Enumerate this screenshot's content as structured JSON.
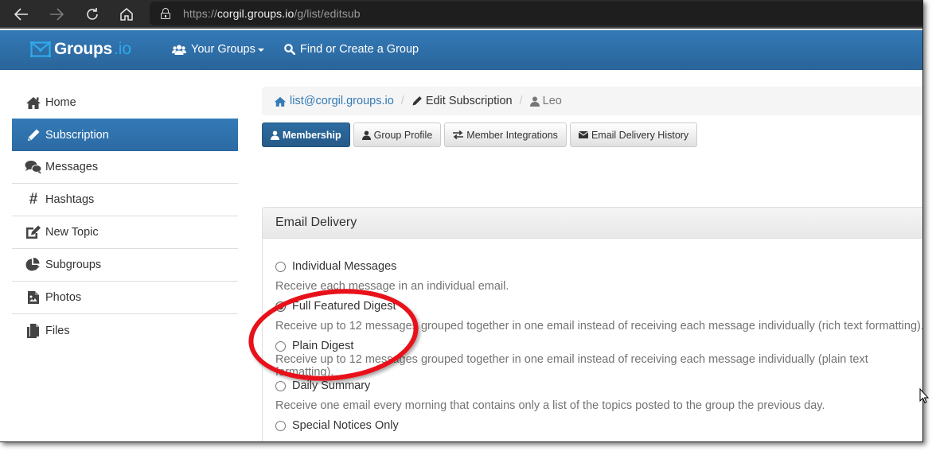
{
  "browser": {
    "url_prefix": "https://",
    "url_host": "corgil.groups.io",
    "url_path": "/g/list/editsub",
    "icons": [
      "back-arrow-icon",
      "forward-arrow-icon",
      "reload-icon",
      "home-icon",
      "lock-icon"
    ]
  },
  "navbar": {
    "brand_name": "Groups",
    "brand_tld": ".io",
    "your_groups_label": "Your Groups",
    "find_label": "Find or Create a Group"
  },
  "sidebar": {
    "items": [
      {
        "label": "Home",
        "icon": "home-icon",
        "active": false
      },
      {
        "label": "Subscription",
        "icon": "pencil-icon",
        "active": true
      },
      {
        "label": "Messages",
        "icon": "comments-icon",
        "active": false
      },
      {
        "label": "Hashtags",
        "icon": "hashtag-icon",
        "active": false
      },
      {
        "label": "New Topic",
        "icon": "edit-icon",
        "active": false
      },
      {
        "label": "Subgroups",
        "icon": "pie-chart-icon",
        "active": false
      },
      {
        "label": "Photos",
        "icon": "photo-file-icon",
        "active": false
      },
      {
        "label": "Files",
        "icon": "files-icon",
        "active": false
      }
    ]
  },
  "breadcrumb": {
    "group": "list@corgil.groups.io",
    "page": "Edit Subscription",
    "user": "Leo",
    "separator": "/"
  },
  "tabs": [
    {
      "label": "Membership",
      "icon": "user-icon",
      "active": true
    },
    {
      "label": "Group Profile",
      "icon": "user-icon",
      "active": false
    },
    {
      "label": "Member Integrations",
      "icon": "exchange-icon",
      "active": false
    },
    {
      "label": "Email Delivery History",
      "icon": "envelope-icon",
      "active": false
    }
  ],
  "email_delivery": {
    "title": "Email Delivery",
    "selected": "Full Featured Digest",
    "options": [
      {
        "label": "Individual Messages",
        "checked": false,
        "description": "Receive each message in an individual email."
      },
      {
        "label": "Full Featured Digest",
        "checked": true,
        "description": "Receive up to 12 messages grouped together in one email instead of receiving each message individually (rich text formatting)."
      },
      {
        "label": "Plain Digest",
        "checked": false,
        "description": "Receive up to 12 messages grouped together in one email instead of receiving each message individually (plain text formatting)."
      },
      {
        "label": "Daily Summary",
        "checked": false,
        "description": "Receive one email every morning that contains only a list of the topics posted to the group the previous day."
      },
      {
        "label": "Special Notices Only",
        "checked": false,
        "description": ""
      }
    ]
  },
  "annotation": {
    "highlight_color": "#e8111a",
    "highlighted_option": "Full Featured Digest"
  },
  "colors": {
    "brand_blue": "#337ab7",
    "brand_tld": "#2fa9e8",
    "browser_bar": "#2b2b2b"
  }
}
